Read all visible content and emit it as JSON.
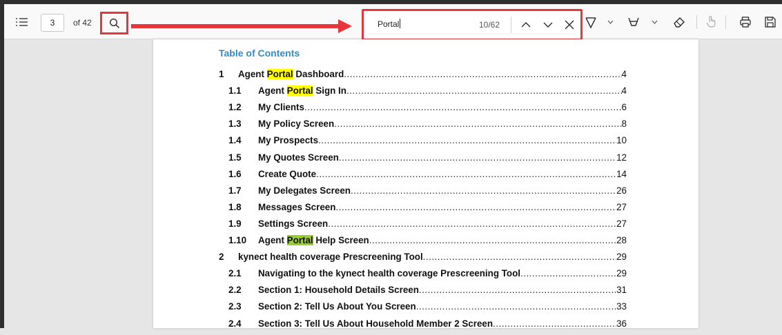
{
  "toolbar": {
    "page_number": "3",
    "page_total_label": "of 42",
    "search": {
      "query": "Portal",
      "count": "10/62"
    }
  },
  "toc": {
    "title": "Table of Contents",
    "highlight_term": "Portal",
    "active_index": 9,
    "rows": [
      {
        "num": "1",
        "before": "Agent ",
        "hl": "Portal",
        "after": " Dashboard",
        "page": "4",
        "level": "main"
      },
      {
        "num": "1.1",
        "before": "Agent ",
        "hl": "Portal",
        "after": " Sign In",
        "page": "4",
        "level": "sub"
      },
      {
        "num": "1.2",
        "before": "My Clients",
        "hl": "",
        "after": "",
        "page": "6",
        "level": "sub"
      },
      {
        "num": "1.3",
        "before": "My Policy Screen",
        "hl": "",
        "after": "",
        "page": "8",
        "level": "sub"
      },
      {
        "num": "1.4",
        "before": "My Prospects",
        "hl": "",
        "after": "",
        "page": "10",
        "level": "sub"
      },
      {
        "num": "1.5",
        "before": "My Quotes Screen",
        "hl": "",
        "after": "",
        "page": "12",
        "level": "sub"
      },
      {
        "num": "1.6",
        "before": "Create Quote",
        "hl": "",
        "after": "",
        "page": "14",
        "level": "sub"
      },
      {
        "num": "1.7",
        "before": "My Delegates Screen",
        "hl": "",
        "after": "",
        "page": "26",
        "level": "sub"
      },
      {
        "num": "1.8",
        "before": "Messages Screen",
        "hl": "",
        "after": "",
        "page": "27",
        "level": "sub"
      },
      {
        "num": "1.9",
        "before": "Settings Screen",
        "hl": "",
        "after": "",
        "page": "27",
        "level": "sub"
      },
      {
        "num": "1.10",
        "before": "Agent ",
        "hl": "Portal",
        "after": " Help Screen",
        "page": "28",
        "level": "sub",
        "active": true
      },
      {
        "num": "2",
        "before": "kynect health coverage Prescreening Tool",
        "hl": "",
        "after": "",
        "page": "29",
        "level": "main"
      },
      {
        "num": "2.1",
        "before": "Navigating to the kynect health coverage Prescreening Tool",
        "hl": "",
        "after": "",
        "page": "29",
        "level": "sub"
      },
      {
        "num": "2.2",
        "before": "Section 1: Household Details Screen",
        "hl": "",
        "after": "",
        "page": "31",
        "level": "sub"
      },
      {
        "num": "2.3",
        "before": "Section 2: Tell Us About You Screen",
        "hl": "",
        "after": "",
        "page": "33",
        "level": "sub"
      },
      {
        "num": "2.4",
        "before": "Section 3: Tell Us About Household Member 2 Screen",
        "hl": "",
        "after": "",
        "page": "36",
        "level": "sub"
      }
    ]
  },
  "colors": {
    "annotation_red": "#e8353b",
    "toc_title_blue": "#2f8bc6",
    "highlight_yellow": "#ffff00",
    "highlight_active": "#9acd32"
  },
  "icons": [
    "contents-list-icon",
    "search-icon",
    "chevron-up-icon",
    "chevron-down-icon",
    "close-icon",
    "draw-icon",
    "highlight-icon",
    "eraser-icon",
    "touch-icon",
    "print-icon",
    "save-icon"
  ]
}
